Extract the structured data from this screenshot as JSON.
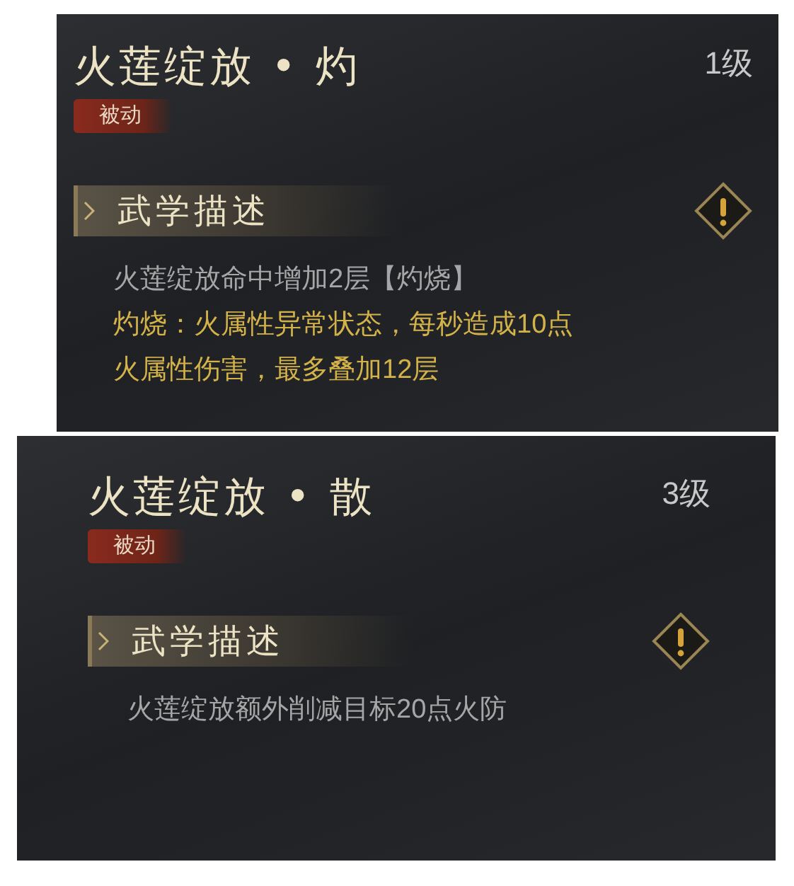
{
  "skills": [
    {
      "title": "火莲绽放 • 灼",
      "level": "1级",
      "tag": "被动",
      "section": "武学描述",
      "lines": [
        {
          "kind": "normal",
          "text": "火莲绽放命中增加2层【灼烧】"
        },
        {
          "kind": "highlight",
          "text": "灼烧：火属性异常状态，每秒造成10点"
        },
        {
          "kind": "highlight",
          "text": "火属性伤害，最多叠加12层"
        }
      ]
    },
    {
      "title": "火莲绽放 • 散",
      "level": "3级",
      "tag": "被动",
      "section": "武学描述",
      "lines": [
        {
          "kind": "normal",
          "text": "火莲绽放额外削减目标20点火防"
        }
      ]
    }
  ]
}
